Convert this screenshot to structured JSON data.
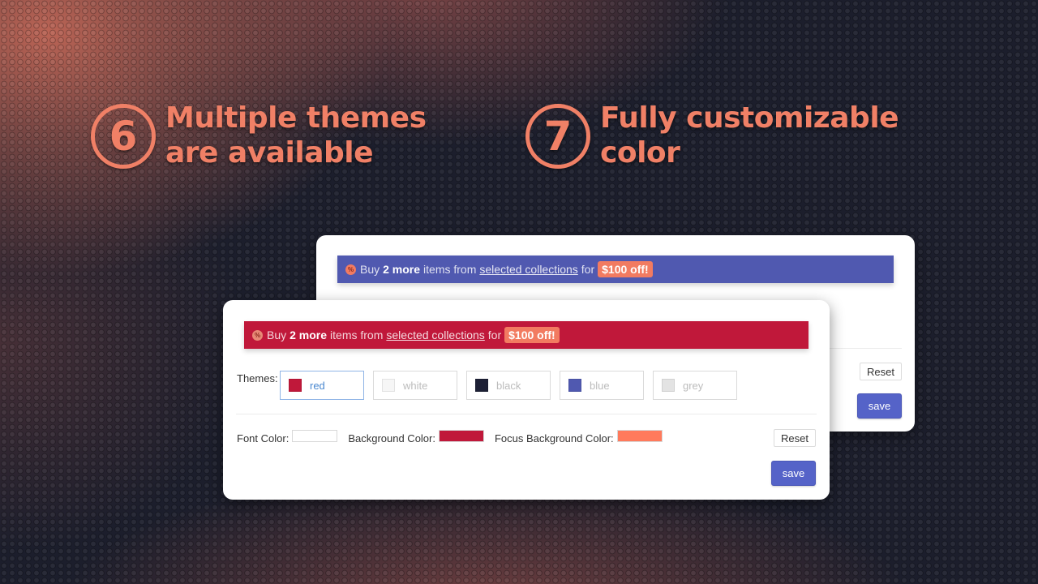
{
  "features": [
    {
      "number": "6",
      "title": "Multiple themes\nare available"
    },
    {
      "number": "7",
      "title": "Fully customizable\ncolor"
    }
  ],
  "colors": {
    "accent": "#f08066",
    "background": "#1c1e2c",
    "save_button": "#5563c8"
  },
  "back_card": {
    "banner": {
      "icon": "discount-badge-icon",
      "prefix": "Buy",
      "count": "2 more",
      "middle": "items from",
      "link": "selected collections",
      "for": "for",
      "offer": "$100 off!",
      "background": "#5059b0"
    },
    "reset_label": "Reset",
    "save_label": "save"
  },
  "front_card": {
    "banner": {
      "icon": "discount-badge-icon",
      "prefix": "Buy",
      "count": "2 more",
      "middle": "items from",
      "link": "selected collections",
      "for": "for",
      "offer": "$100 off!",
      "background": "#c0183a"
    },
    "themes_label": "Themes:",
    "themes": [
      {
        "label": "red",
        "color": "#c0183a",
        "selected": true
      },
      {
        "label": "white",
        "color": "#f6f6f6",
        "selected": false
      },
      {
        "label": "black",
        "color": "#1d2035",
        "selected": false
      },
      {
        "label": "blue",
        "color": "#5059b0",
        "selected": false
      },
      {
        "label": "grey",
        "color": "#e3e3e3",
        "selected": false
      }
    ],
    "font_color_label": "Font Color:",
    "font_color": "#ffffff",
    "background_color_label": "Background Color:",
    "background_color": "#c0183a",
    "focus_background_color_label": "Focus Background Color:",
    "focus_background_color": "#ff7a5c",
    "reset_label": "Reset",
    "save_label": "save"
  }
}
